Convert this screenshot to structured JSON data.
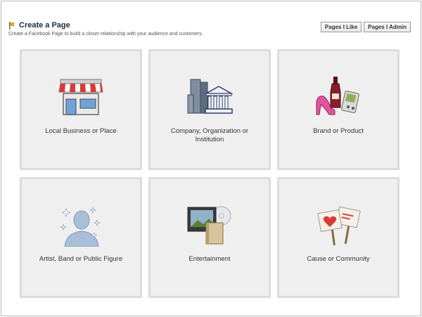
{
  "header": {
    "title": "Create a Page",
    "subtitle": "Create a Facebook Page to build a closer relationship with your audience and customers."
  },
  "buttons": {
    "pages_i_like": "Pages I Like",
    "pages_i_admin": "Pages I Admin"
  },
  "categories": [
    {
      "label": "Local Business or Place",
      "icon": "storefront-icon"
    },
    {
      "label": "Company, Organization or Institution",
      "icon": "buildings-icon"
    },
    {
      "label": "Brand or Product",
      "icon": "products-icon"
    },
    {
      "label": "Artist, Band or Public Figure",
      "icon": "person-silhouette-icon"
    },
    {
      "label": "Entertainment",
      "icon": "tv-book-icon"
    },
    {
      "label": "Cause or Community",
      "icon": "signs-icon"
    }
  ],
  "colors": {
    "title": "#1c2a47",
    "card_bg": "#efefef",
    "card_border": "#dcdcdc"
  }
}
